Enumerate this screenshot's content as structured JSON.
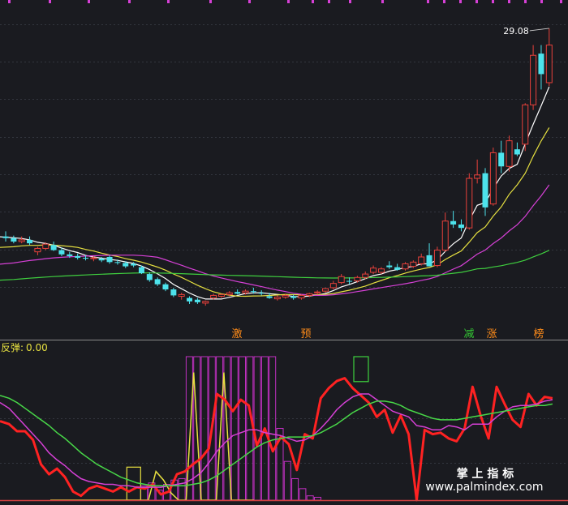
{
  "colors": {
    "background": "#1a1b20",
    "grid": "#33363f",
    "separator": "#9a9a9a",
    "candle_up": "#e8413b",
    "candle_down": "#4de3ec",
    "ma_white": "#ffffff",
    "ma_yellow": "#e6e040",
    "ma_magenta": "#d640d6",
    "ma_green": "#3fcf3f",
    "signal_red": "#ff2222",
    "signal_magenta": "#d640d6",
    "signal_green": "#48d848",
    "bar_magenta": "#c030c0",
    "bar_yellow": "#e8e040",
    "box_green": "#3ed13e",
    "label_orange": "#ff8c1a",
    "label_green": "#34c934"
  },
  "price_panel": {
    "high_label": "29.08",
    "markers": [
      {
        "text": "激",
        "color": "label_orange"
      },
      {
        "text": "预",
        "color": "label_orange"
      },
      {
        "text": "减",
        "color": "label_green"
      },
      {
        "text": "涨",
        "color": "label_orange"
      },
      {
        "text": "榜",
        "color": "label_orange"
      }
    ]
  },
  "indicator_panel": {
    "title": "反弹:",
    "value": "0.00"
  },
  "watermark": {
    "line1": "掌 上 指 标",
    "line2": "www.palmindex.com"
  },
  "chart_data": [
    {
      "type": "candlestick",
      "title": "",
      "ohlc": [
        [
          16.9,
          17.2,
          16.6,
          16.8
        ],
        [
          16.8,
          16.95,
          16.5,
          16.6
        ],
        [
          16.6,
          16.9,
          16.5,
          16.7
        ],
        [
          16.7,
          16.9,
          16.4,
          16.5
        ],
        [
          16.0,
          16.3,
          15.8,
          16.2
        ],
        [
          16.2,
          16.55,
          16.1,
          16.45
        ],
        [
          16.4,
          16.6,
          16.05,
          16.1
        ],
        [
          16.1,
          16.25,
          15.75,
          15.85
        ],
        [
          15.85,
          16.0,
          15.65,
          15.75
        ],
        [
          15.75,
          15.9,
          15.55,
          15.65
        ],
        [
          15.65,
          15.8,
          15.5,
          15.6
        ],
        [
          15.6,
          15.75,
          15.45,
          15.65
        ],
        [
          15.6,
          15.7,
          15.4,
          15.5
        ],
        [
          15.7,
          15.8,
          15.3,
          15.4
        ],
        [
          15.4,
          15.55,
          15.25,
          15.35
        ],
        [
          15.35,
          15.45,
          15.05,
          15.15
        ],
        [
          15.3,
          15.4,
          15.1,
          15.2
        ],
        [
          15.1,
          15.2,
          14.7,
          14.75
        ],
        [
          14.7,
          14.8,
          14.25,
          14.35
        ],
        [
          14.4,
          14.5,
          14.0,
          14.1
        ],
        [
          14.1,
          14.2,
          13.7,
          13.8
        ],
        [
          13.8,
          13.9,
          13.35,
          13.45
        ],
        [
          13.4,
          13.6,
          13.2,
          13.5
        ],
        [
          13.3,
          13.4,
          12.95,
          13.1
        ],
        [
          13.2,
          13.3,
          12.95,
          13.05
        ],
        [
          13.0,
          13.15,
          12.85,
          13.1
        ],
        [
          13.3,
          13.55,
          13.2,
          13.45
        ],
        [
          13.4,
          13.55,
          13.3,
          13.5
        ],
        [
          13.5,
          13.7,
          13.4,
          13.6
        ],
        [
          13.65,
          13.8,
          13.5,
          13.55
        ],
        [
          13.6,
          13.8,
          13.5,
          13.7
        ],
        [
          13.7,
          13.9,
          13.55,
          13.65
        ],
        [
          13.6,
          13.75,
          13.45,
          13.55
        ],
        [
          13.4,
          13.6,
          13.25,
          13.3
        ],
        [
          13.25,
          13.45,
          13.15,
          13.35
        ],
        [
          13.35,
          13.55,
          13.25,
          13.45
        ],
        [
          13.4,
          13.5,
          13.2,
          13.3
        ],
        [
          13.3,
          13.5,
          13.2,
          13.45
        ],
        [
          13.45,
          13.6,
          13.35,
          13.55
        ],
        [
          13.6,
          13.75,
          13.5,
          13.65
        ],
        [
          13.7,
          13.9,
          13.6,
          13.85
        ],
        [
          13.9,
          14.3,
          13.8,
          14.15
        ],
        [
          14.2,
          14.7,
          14.1,
          14.55
        ],
        [
          14.3,
          14.5,
          14.1,
          14.25
        ],
        [
          14.3,
          14.6,
          14.2,
          14.5
        ],
        [
          14.5,
          14.85,
          14.4,
          14.7
        ],
        [
          14.8,
          15.2,
          14.7,
          15.05
        ],
        [
          14.8,
          15.1,
          14.7,
          15.0
        ],
        [
          15.2,
          15.45,
          15.0,
          15.1
        ],
        [
          15.1,
          15.3,
          14.9,
          14.95
        ],
        [
          15.0,
          15.4,
          14.9,
          15.3
        ],
        [
          15.15,
          15.5,
          15.05,
          15.4
        ],
        [
          15.3,
          15.9,
          15.2,
          15.7
        ],
        [
          15.8,
          16.5,
          15.7,
          15.15
        ],
        [
          15.2,
          16.3,
          15.1,
          16.1
        ],
        [
          16.1,
          18.3,
          16.0,
          17.8
        ],
        [
          17.8,
          18.4,
          17.4,
          17.6
        ],
        [
          17.6,
          17.9,
          17.2,
          17.4
        ],
        [
          17.4,
          20.6,
          17.3,
          20.3
        ],
        [
          20.3,
          21.4,
          20.0,
          20.5
        ],
        [
          20.6,
          20.9,
          18.1,
          18.6
        ],
        [
          18.8,
          22.1,
          18.7,
          21.8
        ],
        [
          21.8,
          22.5,
          20.6,
          21.0
        ],
        [
          21.0,
          22.8,
          20.7,
          22.5
        ],
        [
          22.0,
          22.4,
          21.6,
          21.7
        ],
        [
          22.3,
          24.7,
          21.9,
          24.6
        ],
        [
          24.6,
          28.1,
          24.3,
          27.5
        ],
        [
          27.6,
          28.1,
          25.5,
          26.4
        ],
        [
          25.9,
          29.08,
          25.7,
          28.1
        ]
      ],
      "moving_averages": [
        {
          "name": "MA5",
          "color": "ma_white",
          "visible_from": 0
        },
        {
          "name": "MA10",
          "color": "ma_yellow",
          "visible_from": 0
        },
        {
          "name": "MA20",
          "color": "ma_magenta",
          "visible_from": 0
        },
        {
          "name": "MA60",
          "color": "ma_green",
          "visible_from": 0
        }
      ],
      "ylim": [
        12.0,
        30.5
      ]
    },
    {
      "type": "indicator",
      "title": "反弹",
      "ylim": [
        0,
        100
      ],
      "x_offset": -2,
      "series": [
        {
          "color": "signal_red",
          "width": 3,
          "values": [
            55,
            53,
            48,
            48,
            42,
            25,
            18,
            22,
            16,
            6,
            3,
            8,
            10,
            8,
            6,
            9,
            6,
            9,
            8,
            11,
            4,
            6,
            18,
            20,
            25,
            29,
            36,
            74,
            70,
            62,
            70,
            66,
            38,
            50,
            34,
            44,
            39,
            21,
            46,
            43,
            71,
            78,
            83,
            85,
            78,
            73,
            68,
            58,
            63,
            47,
            59,
            46,
            0,
            49,
            46,
            47,
            43,
            41,
            50,
            79,
            59,
            43,
            79,
            67,
            56,
            51,
            74,
            66,
            72,
            71
          ]
        },
        {
          "color": "signal_magenta",
          "width": 1.5,
          "values": [
            68,
            64,
            58,
            52,
            46,
            40,
            33,
            28,
            24,
            19,
            15,
            13,
            12,
            11,
            11,
            10,
            10,
            9,
            9,
            9,
            9,
            10,
            11,
            12,
            15,
            19,
            26,
            34,
            40,
            45,
            47,
            49,
            49,
            47,
            46,
            45,
            43,
            41,
            42,
            45,
            50,
            56,
            63,
            68,
            72,
            74,
            74,
            70,
            66,
            62,
            60,
            58,
            52,
            51,
            49,
            49,
            52,
            51,
            49,
            53,
            53,
            53,
            58,
            62,
            65,
            66,
            66,
            67,
            69,
            70
          ]
        },
        {
          "color": "signal_green",
          "width": 1.5,
          "values": [
            73,
            71,
            68,
            64,
            60,
            56,
            52,
            47,
            43,
            38,
            33,
            29,
            25,
            22,
            19,
            16,
            14,
            12,
            11,
            10,
            10,
            10,
            10,
            10,
            11,
            12,
            14,
            17,
            21,
            25,
            29,
            33,
            37,
            40,
            42,
            43,
            44,
            44,
            44,
            45,
            47,
            50,
            53,
            57,
            61,
            64,
            67,
            69,
            69,
            68,
            66,
            63,
            61,
            59,
            57,
            56,
            56,
            56,
            57,
            58,
            59,
            60,
            61,
            62,
            63,
            64,
            65,
            66,
            66,
            67
          ]
        }
      ],
      "magenta_bars": {
        "values": [
          0,
          0,
          0,
          0,
          0,
          0,
          0,
          0,
          0,
          0,
          0,
          0,
          10,
          12,
          7,
          11,
          14,
          15,
          100,
          100,
          100,
          100,
          100,
          100,
          100,
          100,
          100,
          100,
          100,
          100,
          50,
          27,
          15,
          8,
          3,
          2,
          0,
          0,
          0,
          0
        ],
        "x_offset": 0
      },
      "yellow_spikes": {
        "values": [
          0,
          0,
          0,
          0,
          0,
          0,
          0,
          0,
          0,
          0,
          0,
          0,
          0,
          0,
          20,
          14,
          5,
          0,
          0,
          89,
          0,
          0,
          0,
          89,
          0,
          0,
          0,
          0
        ]
      },
      "yellow_box": {
        "index": 11,
        "value": 23
      },
      "green_box": {
        "index": 56,
        "low": 86,
        "high": 100
      }
    }
  ]
}
